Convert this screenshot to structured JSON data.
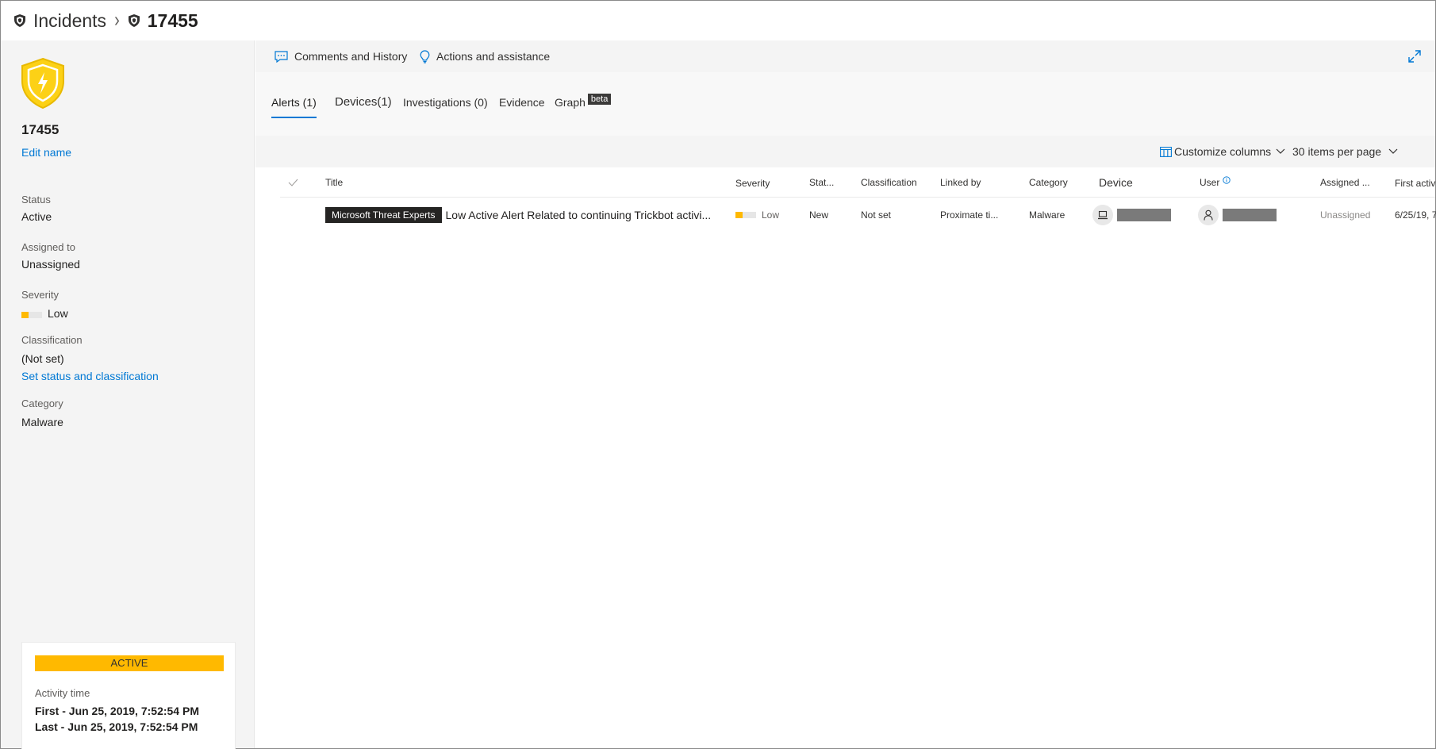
{
  "breadcrumb": {
    "root": "Incidents",
    "current": "17455"
  },
  "incident": {
    "id": "17455",
    "edit_name": "Edit name",
    "status_label": "Status",
    "status_value": "Active",
    "assigned_label": "Assigned to",
    "assigned_value": "Unassigned",
    "severity_label": "Severity",
    "severity_value": "Low",
    "classification_label": "Classification",
    "classification_value": "(Not set)",
    "set_status_link": "Set status and classification",
    "category_label": "Category",
    "category_value": "Malware"
  },
  "activity": {
    "badge": "ACTIVE",
    "label": "Activity time",
    "first": "First - Jun 25, 2019, 7:52:54 PM",
    "last": "Last - Jun 25, 2019, 7:52:54 PM"
  },
  "actions": {
    "comments": "Comments and History",
    "assistance": "Actions and assistance"
  },
  "tabs": [
    {
      "label": "Alerts (1)"
    },
    {
      "label": "Devices(1)"
    },
    {
      "label": "Investigations (0)"
    },
    {
      "label": "Evidence"
    },
    {
      "label": "Graph",
      "badge": "beta"
    }
  ],
  "toolbar": {
    "customize": "Customize columns",
    "per_page": "30 items per page"
  },
  "table": {
    "columns": [
      "Title",
      "Severity",
      "Stat...",
      "Classification",
      "Linked by",
      "Category",
      "Device",
      "User",
      "Assigned ...",
      "First activ"
    ],
    "rows": [
      {
        "tag": "Microsoft Threat Experts",
        "title": "Low Active Alert Related to continuing Trickbot activi...",
        "severity": "Low",
        "status": "New",
        "classification": "Not set",
        "linked_by": "Proximate ti...",
        "category": "Malware",
        "assigned": "Unassigned",
        "first_activity": "6/25/19, 7"
      }
    ]
  },
  "colors": {
    "accent": "#0078d4",
    "severity_low": "#ffb900",
    "active_band": "#ffb900",
    "shield": "#fcd116"
  }
}
